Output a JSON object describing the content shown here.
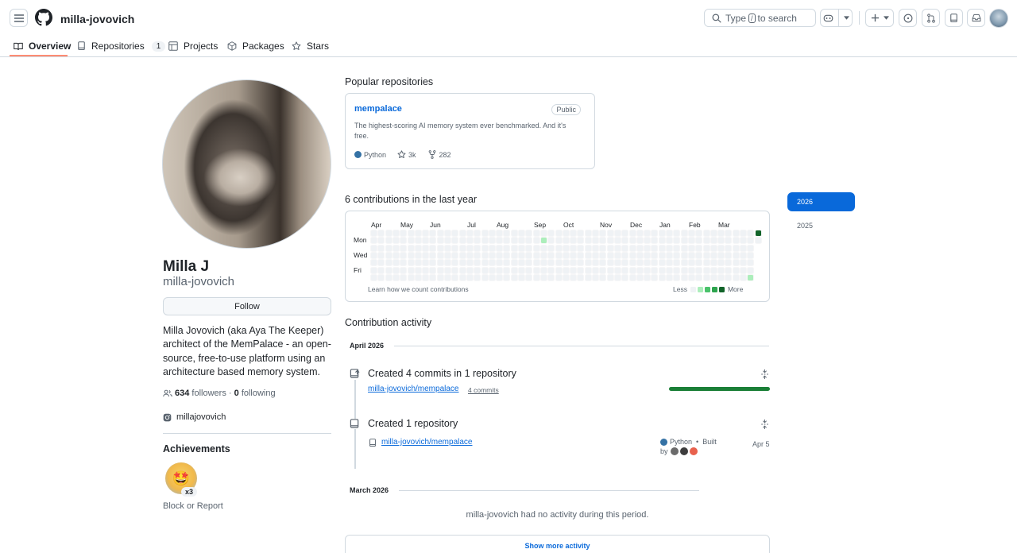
{
  "header": {
    "username": "milla-jovovich",
    "search_text_before": "Type",
    "search_key": "/",
    "search_text_after": "to search"
  },
  "tabs": [
    {
      "label": "Overview",
      "active": true
    },
    {
      "label": "Repositories",
      "count": "1"
    },
    {
      "label": "Projects"
    },
    {
      "label": "Packages"
    },
    {
      "label": "Stars"
    }
  ],
  "profile": {
    "name": "Milla J",
    "login": "milla-jovovich",
    "follow_label": "Follow",
    "bio": "Milla Jovovich (aka Aya The Keeper) architect of the MemPalace - an open-source, free-to-use platform using an architecture based memory system.",
    "followers_count": "634",
    "followers_label": "followers",
    "separator": "·",
    "following_count": "0",
    "following_label": "following",
    "instagram": "millajovovich",
    "achievements_title": "Achievements",
    "achievement_multiplier": "x3",
    "block_label": "Block or Report"
  },
  "popular": {
    "title": "Popular repositories",
    "repo": {
      "name": "mempalace",
      "visibility": "Public",
      "description": "The highest-scoring AI memory system ever benchmarked. And it's free.",
      "language": "Python",
      "language_color": "#3572a5",
      "stars": "3k",
      "forks": "282"
    }
  },
  "contributions": {
    "title": "6 contributions in the last year",
    "months": [
      "Apr",
      "May",
      "Jun",
      "Jul",
      "Aug",
      "Sep",
      "Oct",
      "Nov",
      "Dec",
      "Jan",
      "Feb",
      "Mar"
    ],
    "day_labels": [
      "Mon",
      "Wed",
      "Fri"
    ],
    "learn_link": "Learn how we count contributions",
    "legend_less": "Less",
    "legend_more": "More",
    "level_colors": [
      "#eff2f5",
      "#aceebb",
      "#4ac26b",
      "#2da44e",
      "#116329"
    ],
    "active_cells": [
      {
        "week": 23,
        "day": 1,
        "level": 1
      },
      {
        "week": 52,
        "day": 0,
        "level": 4
      },
      {
        "week": 51,
        "day": 6,
        "level": 1
      }
    ],
    "years": [
      "2026",
      "2025"
    ],
    "selected_year": "2026"
  },
  "activity": {
    "title": "Contribution activity",
    "april_header": "April 2026",
    "commits_title": "Created 4 commits in 1 repository",
    "commits_repo": "milla-jovovich/mempalace",
    "commits_count": "4 commits",
    "commits_share_pct": 100,
    "created_title": "Created 1 repository",
    "created_repo": "milla-jovovich/mempalace",
    "created_language": "Python",
    "created_bullet": "•",
    "created_built": "Built",
    "created_by": "by",
    "created_date": "Apr 5",
    "march_header": "March 2026",
    "no_activity": "milla-jovovich had no activity during this period.",
    "show_more": "Show more activity"
  }
}
